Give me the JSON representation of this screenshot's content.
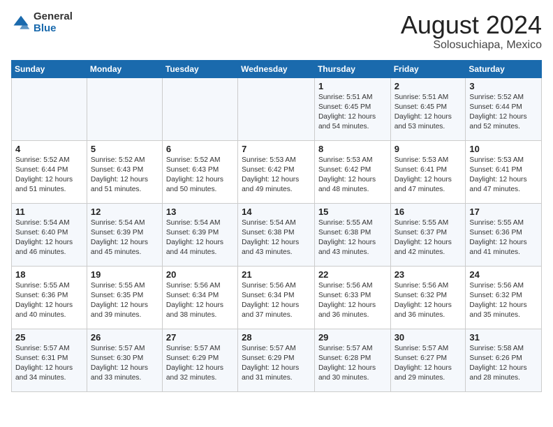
{
  "logo": {
    "general": "General",
    "blue": "Blue"
  },
  "title": "August 2024",
  "subtitle": "Solosuchiapa, Mexico",
  "days_of_week": [
    "Sunday",
    "Monday",
    "Tuesday",
    "Wednesday",
    "Thursday",
    "Friday",
    "Saturday"
  ],
  "weeks": [
    [
      {
        "day": "",
        "info": ""
      },
      {
        "day": "",
        "info": ""
      },
      {
        "day": "",
        "info": ""
      },
      {
        "day": "",
        "info": ""
      },
      {
        "day": "1",
        "info": "Sunrise: 5:51 AM\nSunset: 6:45 PM\nDaylight: 12 hours\nand 54 minutes."
      },
      {
        "day": "2",
        "info": "Sunrise: 5:51 AM\nSunset: 6:45 PM\nDaylight: 12 hours\nand 53 minutes."
      },
      {
        "day": "3",
        "info": "Sunrise: 5:52 AM\nSunset: 6:44 PM\nDaylight: 12 hours\nand 52 minutes."
      }
    ],
    [
      {
        "day": "4",
        "info": "Sunrise: 5:52 AM\nSunset: 6:44 PM\nDaylight: 12 hours\nand 51 minutes."
      },
      {
        "day": "5",
        "info": "Sunrise: 5:52 AM\nSunset: 6:43 PM\nDaylight: 12 hours\nand 51 minutes."
      },
      {
        "day": "6",
        "info": "Sunrise: 5:52 AM\nSunset: 6:43 PM\nDaylight: 12 hours\nand 50 minutes."
      },
      {
        "day": "7",
        "info": "Sunrise: 5:53 AM\nSunset: 6:42 PM\nDaylight: 12 hours\nand 49 minutes."
      },
      {
        "day": "8",
        "info": "Sunrise: 5:53 AM\nSunset: 6:42 PM\nDaylight: 12 hours\nand 48 minutes."
      },
      {
        "day": "9",
        "info": "Sunrise: 5:53 AM\nSunset: 6:41 PM\nDaylight: 12 hours\nand 47 minutes."
      },
      {
        "day": "10",
        "info": "Sunrise: 5:53 AM\nSunset: 6:41 PM\nDaylight: 12 hours\nand 47 minutes."
      }
    ],
    [
      {
        "day": "11",
        "info": "Sunrise: 5:54 AM\nSunset: 6:40 PM\nDaylight: 12 hours\nand 46 minutes."
      },
      {
        "day": "12",
        "info": "Sunrise: 5:54 AM\nSunset: 6:39 PM\nDaylight: 12 hours\nand 45 minutes."
      },
      {
        "day": "13",
        "info": "Sunrise: 5:54 AM\nSunset: 6:39 PM\nDaylight: 12 hours\nand 44 minutes."
      },
      {
        "day": "14",
        "info": "Sunrise: 5:54 AM\nSunset: 6:38 PM\nDaylight: 12 hours\nand 43 minutes."
      },
      {
        "day": "15",
        "info": "Sunrise: 5:55 AM\nSunset: 6:38 PM\nDaylight: 12 hours\nand 43 minutes."
      },
      {
        "day": "16",
        "info": "Sunrise: 5:55 AM\nSunset: 6:37 PM\nDaylight: 12 hours\nand 42 minutes."
      },
      {
        "day": "17",
        "info": "Sunrise: 5:55 AM\nSunset: 6:36 PM\nDaylight: 12 hours\nand 41 minutes."
      }
    ],
    [
      {
        "day": "18",
        "info": "Sunrise: 5:55 AM\nSunset: 6:36 PM\nDaylight: 12 hours\nand 40 minutes."
      },
      {
        "day": "19",
        "info": "Sunrise: 5:55 AM\nSunset: 6:35 PM\nDaylight: 12 hours\nand 39 minutes."
      },
      {
        "day": "20",
        "info": "Sunrise: 5:56 AM\nSunset: 6:34 PM\nDaylight: 12 hours\nand 38 minutes."
      },
      {
        "day": "21",
        "info": "Sunrise: 5:56 AM\nSunset: 6:34 PM\nDaylight: 12 hours\nand 37 minutes."
      },
      {
        "day": "22",
        "info": "Sunrise: 5:56 AM\nSunset: 6:33 PM\nDaylight: 12 hours\nand 36 minutes."
      },
      {
        "day": "23",
        "info": "Sunrise: 5:56 AM\nSunset: 6:32 PM\nDaylight: 12 hours\nand 36 minutes."
      },
      {
        "day": "24",
        "info": "Sunrise: 5:56 AM\nSunset: 6:32 PM\nDaylight: 12 hours\nand 35 minutes."
      }
    ],
    [
      {
        "day": "25",
        "info": "Sunrise: 5:57 AM\nSunset: 6:31 PM\nDaylight: 12 hours\nand 34 minutes."
      },
      {
        "day": "26",
        "info": "Sunrise: 5:57 AM\nSunset: 6:30 PM\nDaylight: 12 hours\nand 33 minutes."
      },
      {
        "day": "27",
        "info": "Sunrise: 5:57 AM\nSunset: 6:29 PM\nDaylight: 12 hours\nand 32 minutes."
      },
      {
        "day": "28",
        "info": "Sunrise: 5:57 AM\nSunset: 6:29 PM\nDaylight: 12 hours\nand 31 minutes."
      },
      {
        "day": "29",
        "info": "Sunrise: 5:57 AM\nSunset: 6:28 PM\nDaylight: 12 hours\nand 30 minutes."
      },
      {
        "day": "30",
        "info": "Sunrise: 5:57 AM\nSunset: 6:27 PM\nDaylight: 12 hours\nand 29 minutes."
      },
      {
        "day": "31",
        "info": "Sunrise: 5:58 AM\nSunset: 6:26 PM\nDaylight: 12 hours\nand 28 minutes."
      }
    ]
  ]
}
